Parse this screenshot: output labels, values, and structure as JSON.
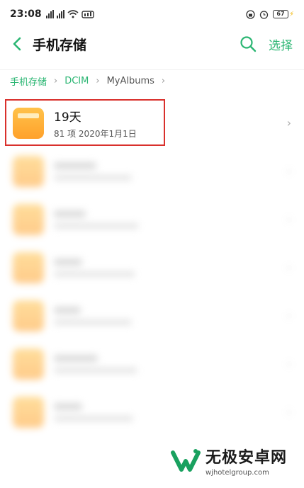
{
  "status_bar": {
    "time": "23:08",
    "battery": "67"
  },
  "header": {
    "title": "手机存储",
    "select_label": "选择"
  },
  "breadcrumb": [
    "手机存储",
    "DCIM",
    "MyAlbums"
  ],
  "list": {
    "highlighted": {
      "name": "19天",
      "count": "81 项",
      "date": "2020年1月1日"
    },
    "blurred_rows": 6
  },
  "watermark": {
    "brand": "无极安卓网",
    "url": "wjhotelgroup.com"
  },
  "colors": {
    "accent": "#2bb673",
    "folder": "#ffa12b",
    "highlight_border": "#d9302c"
  }
}
